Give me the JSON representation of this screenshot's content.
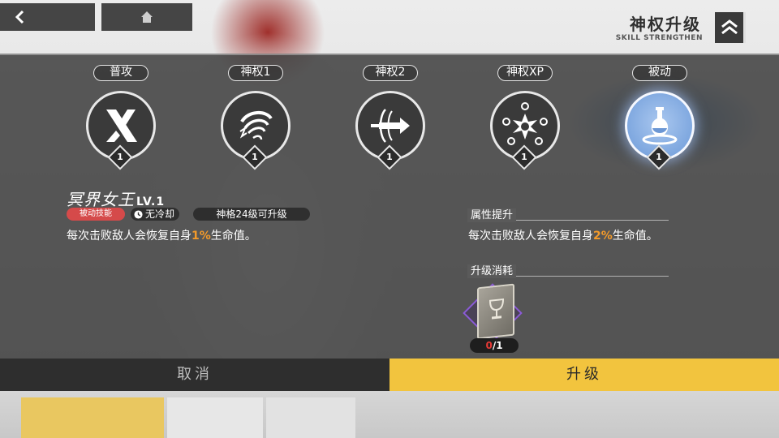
{
  "header": {
    "title": "神权升级",
    "subtitle": "SKILL STRENGTHEN",
    "back_icon": "chevron-left-icon",
    "home_icon": "home-icon",
    "menu_icon": "double-chevron-up-icon"
  },
  "skills": [
    {
      "label": "普攻",
      "level": "1",
      "icon": "crossed-blades-icon"
    },
    {
      "label": "神权1",
      "level": "1",
      "icon": "vortex-icon"
    },
    {
      "label": "神权2",
      "level": "1",
      "icon": "piercing-arrow-icon"
    },
    {
      "label": "神权XP",
      "level": "1",
      "icon": "burst-orbs-icon"
    },
    {
      "label": "被动",
      "level": "1",
      "icon": "potion-flask-icon",
      "active": true
    }
  ],
  "current_skill": {
    "name": "冥界女王",
    "level_text": "LV.1",
    "type_badge": "被动技能",
    "cooldown": "无冷却",
    "requirement": "神格24级可升级",
    "desc_prefix": "每次击败敌人会恢复自身",
    "desc_value": "1%",
    "desc_suffix": "生命值。"
  },
  "upgrade": {
    "attr_header": "属性提升",
    "desc_prefix": "每次击败敌人会恢复自身",
    "desc_value": "2%",
    "desc_suffix": "生命值。",
    "cost_header": "升级消耗",
    "cost_item_icon": "skill-book-icon",
    "cost_have": "0",
    "cost_need": "/1"
  },
  "buttons": {
    "cancel": "取消",
    "upgrade": "升级"
  },
  "colors": {
    "accent_yellow": "#f2c43e",
    "highlight_orange": "#f39a2a",
    "passive_badge": "#d54a4a",
    "active_skill_blue": "#7ea7df"
  }
}
